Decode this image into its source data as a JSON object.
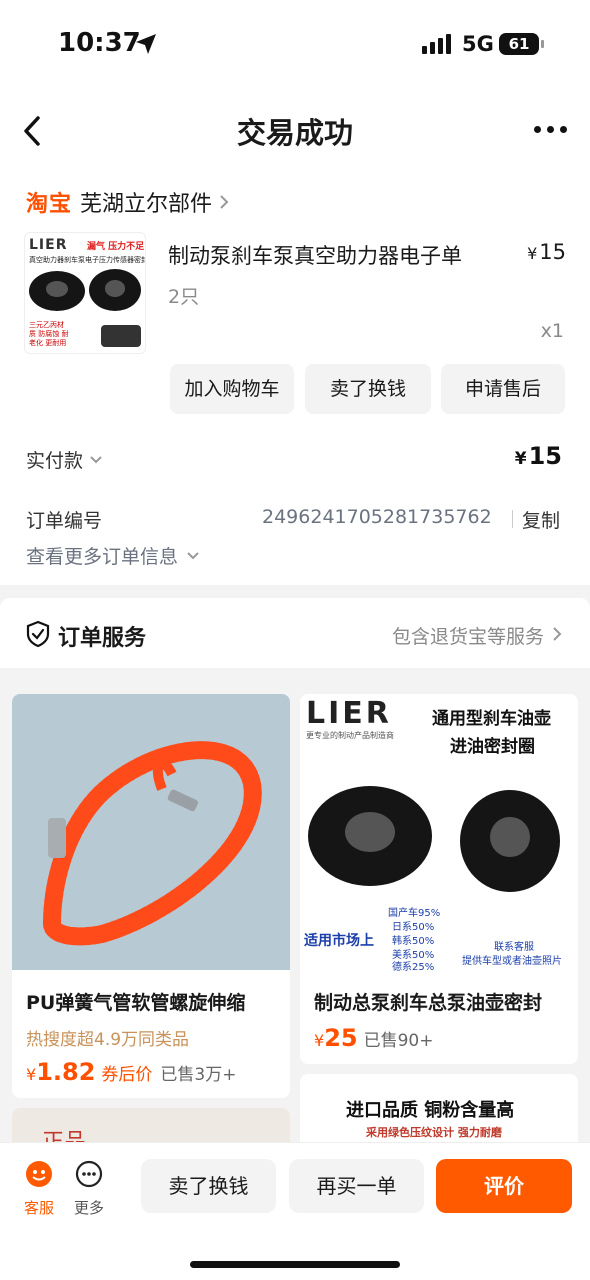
{
  "status_bar": {
    "time": "10:37",
    "network": "5G",
    "battery": "61"
  },
  "nav": {
    "title": "交易成功"
  },
  "shop": {
    "platform": "淘宝",
    "name": "芜湖立尔部件"
  },
  "product": {
    "image": {
      "brand": "LIER",
      "tag": "漏气 压力不足",
      "desc": "真空助力器刹车泵电子压力传感器密封圈",
      "notes": "三元乙丙材质 防腐蚀 耐老化 更耐用"
    },
    "title": "制动泵刹车泵真空助力器电子单",
    "spec": "2只",
    "price_symbol": "¥",
    "price": "15",
    "quantity": "x1"
  },
  "actions": [
    "加入购物车",
    "卖了换钱",
    "申请售后"
  ],
  "payment": {
    "label": "实付款",
    "symbol": "¥",
    "amount": "15"
  },
  "order": {
    "label": "订单编号",
    "number": "2496241705281735762",
    "copy": "复制",
    "more": "查看更多订单信息"
  },
  "service": {
    "title": "订单服务",
    "desc": "包含退货宝等服务"
  },
  "recommendations": [
    {
      "title": "PU弹簧气管软管螺旋伸缩",
      "hot": "热搜度超4.9万同类品",
      "price_symbol": "¥",
      "price": "1.82",
      "coupon": "券后价",
      "sold": "已售3万+"
    },
    {
      "image": {
        "brand": "LIER",
        "tagline": "更专业的制动产品制造商",
        "headline1": "通用型刹车油壶",
        "headline2": "进油密封圈",
        "market_label": "适用市场上",
        "stats": [
          "国产车95%",
          "日系50%",
          "韩系50%",
          "美系50%",
          "德系25%"
        ],
        "contact1": "联系客服",
        "contact2": "提供车型或者油壶照片"
      },
      "title": "制动总泵刹车总泵油壶密封",
      "price_symbol": "¥",
      "price": "25",
      "sold": "已售90+"
    },
    {
      "image": {
        "title": "进口品质 铜粉含量高",
        "subtitle": "采用绿色压纹设计 强力耐磨"
      }
    },
    {
      "image": {
        "stamp": "正品"
      }
    }
  ],
  "bottom_bar": {
    "service_label": "客服",
    "more_label": "更多",
    "sell_label": "卖了换钱",
    "rebuy_label": "再买一单",
    "review_label": "评价"
  }
}
